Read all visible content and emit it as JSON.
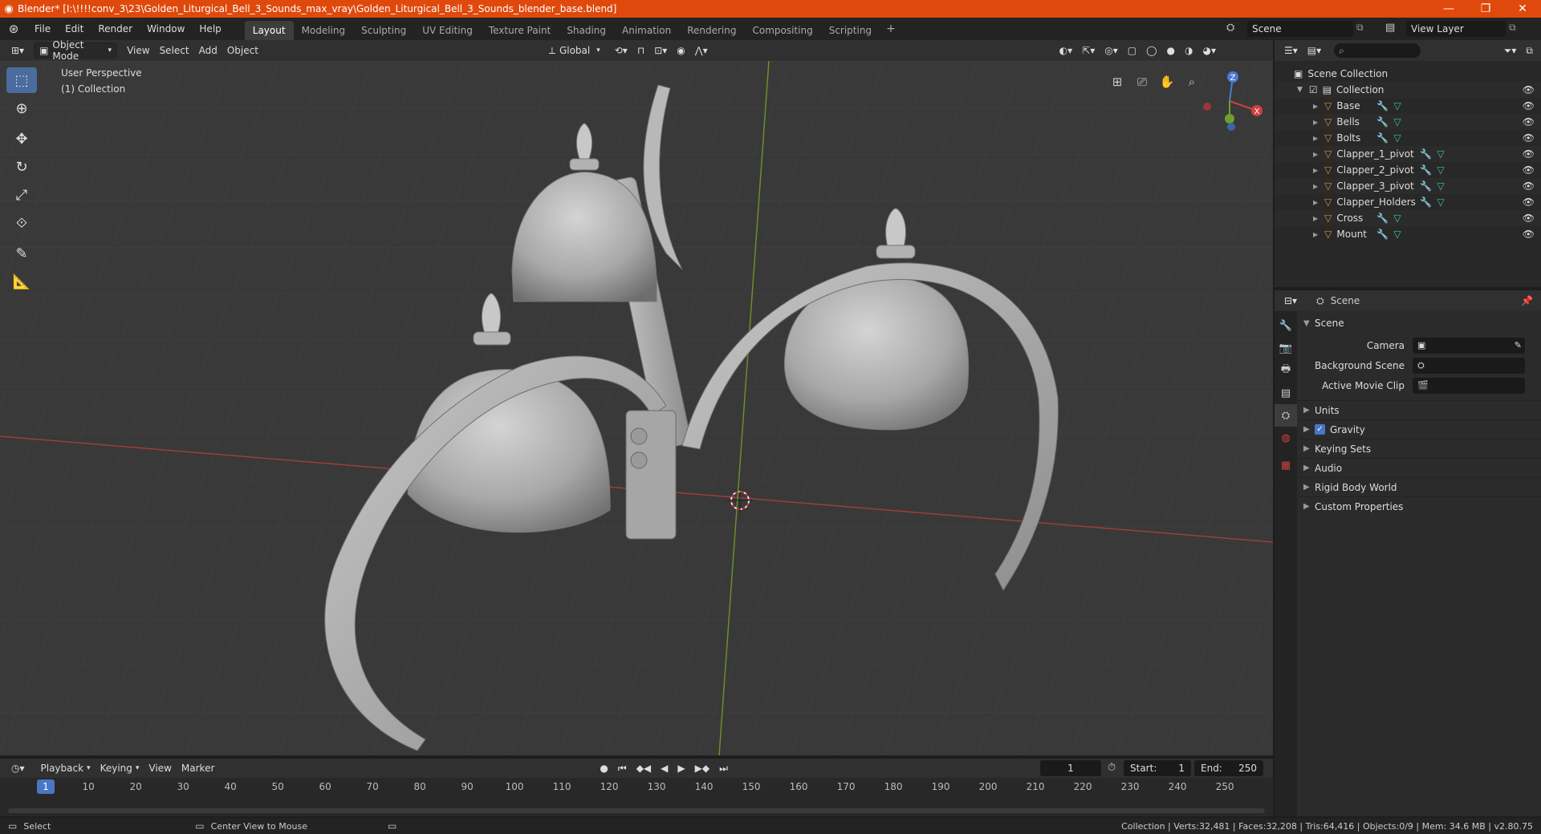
{
  "window": {
    "title": "Blender* [I:\\!!!!conv_3\\23\\Golden_Liturgical_Bell_3_Sounds_max_vray\\Golden_Liturgical_Bell_3_Sounds_blender_base.blend]",
    "minimize": "—",
    "maximize": "❐",
    "close": "✕"
  },
  "menu": [
    "File",
    "Edit",
    "Render",
    "Window",
    "Help"
  ],
  "workspaces": [
    {
      "label": "Layout",
      "active": true
    },
    {
      "label": "Modeling"
    },
    {
      "label": "Sculpting"
    },
    {
      "label": "UV Editing"
    },
    {
      "label": "Texture Paint"
    },
    {
      "label": "Shading"
    },
    {
      "label": "Animation"
    },
    {
      "label": "Rendering"
    },
    {
      "label": "Compositing"
    },
    {
      "label": "Scripting"
    }
  ],
  "scene_selector": "Scene",
  "view_layer": "View Layer",
  "viewport_header": {
    "mode": "Object Mode",
    "menus": [
      "View",
      "Select",
      "Add",
      "Object"
    ],
    "transform_orientation": "Global"
  },
  "viewport": {
    "perspective_label": "User Perspective",
    "collection_label": "(1) Collection",
    "axes": {
      "z": "Z",
      "x": "X"
    }
  },
  "timeline_header": {
    "menus": [
      "Playback",
      "Keying",
      "View",
      "Marker"
    ],
    "current_frame": "1",
    "start_label": "Start:",
    "start_value": "1",
    "end_label": "End:",
    "end_value": "250"
  },
  "timeline": {
    "current": "1",
    "ticks": [
      "10",
      "20",
      "30",
      "40",
      "50",
      "60",
      "70",
      "80",
      "90",
      "100",
      "110",
      "120",
      "130",
      "140",
      "150",
      "160",
      "170",
      "180",
      "190",
      "200",
      "210",
      "220",
      "230",
      "240",
      "250"
    ]
  },
  "statusbar": {
    "left_action": "Select",
    "middle_action": "Center View to Mouse",
    "stats": "Collection | Verts:32,481 | Faces:32,208 | Tris:64,416 | Objects:0/9 | Mem: 34.6 MB | v2.80.75"
  },
  "outliner": {
    "root": "Scene Collection",
    "collection": "Collection",
    "objects": [
      "Base",
      "Bells",
      "Bolts",
      "Clapper_1_pivot",
      "Clapper_2_pivot",
      "Clapper_3_pivot",
      "Clapper_Holders",
      "Cross",
      "Mount"
    ]
  },
  "properties": {
    "header_title": "Scene",
    "panel": "Scene",
    "rows": [
      {
        "label": "Camera"
      },
      {
        "label": "Background Scene"
      },
      {
        "label": "Active Movie Clip"
      }
    ],
    "subpanels": [
      {
        "label": "Units"
      },
      {
        "label": "Gravity",
        "checked": true
      },
      {
        "label": "Keying Sets"
      },
      {
        "label": "Audio"
      },
      {
        "label": "Rigid Body World"
      },
      {
        "label": "Custom Properties"
      }
    ]
  }
}
